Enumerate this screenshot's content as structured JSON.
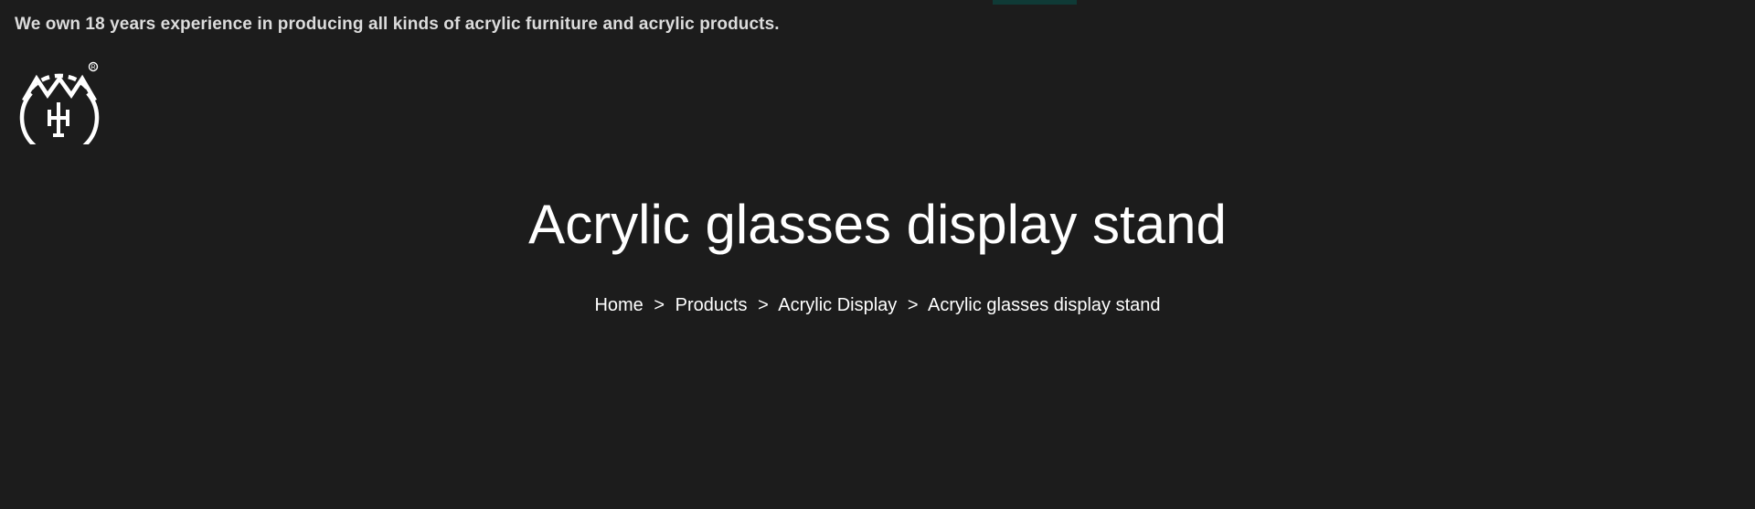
{
  "header": {
    "tagline": "We own 18 years experience in producing all kinds of acrylic furniture and acrylic products.",
    "logo_icon": "company-logo-icon",
    "accent_color": "#0f3a36"
  },
  "main": {
    "title": "Acrylic glasses display stand"
  },
  "breadcrumb": {
    "separator": ">",
    "items": [
      {
        "label": "Home"
      },
      {
        "label": "Products"
      },
      {
        "label": "Acrylic Display"
      },
      {
        "label": "Acrylic glasses display stand"
      }
    ]
  },
  "colors": {
    "background": "#1c1c1c",
    "text": "#ffffff",
    "tagline": "#dcdcdc"
  }
}
